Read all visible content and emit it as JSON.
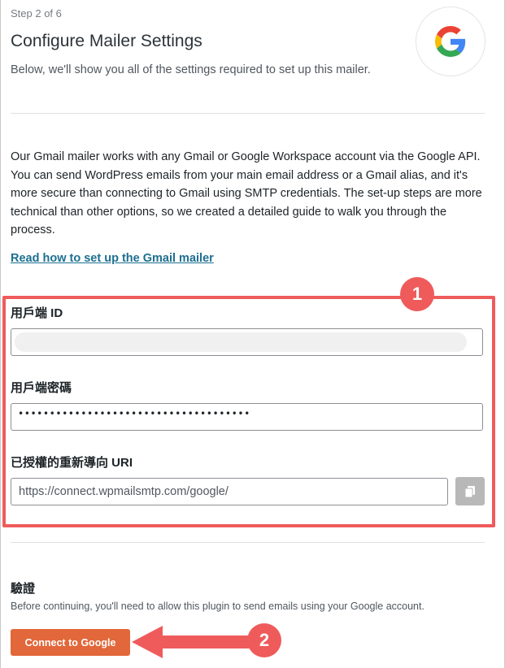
{
  "header": {
    "step": "Step 2 of 6",
    "title": "Configure Mailer Settings",
    "subtitle": "Below, we'll show you all of the settings required to set up this mailer.",
    "logo_icon": "google-g-logo"
  },
  "intro": {
    "description": "Our Gmail mailer works with any Gmail or Google Workspace account via the Google API. You can send WordPress emails from your main email address or a Gmail alias, and it's more secure than connecting to Gmail using SMTP credentials. The set-up steps are more technical than other options, so we created a detailed guide to walk you through the process.",
    "guide_link": "Read how to set up the Gmail mailer"
  },
  "fields": {
    "client_id_label": "用戶端 ID",
    "client_id_value": "",
    "client_secret_label": "用戶端密碼",
    "client_secret_value": "•••••••••••••••••••••••••••••••••••••",
    "redirect_uri_label": "已授權的重新導向 URI",
    "redirect_uri_value": "https://connect.wpmailsmtp.com/google/",
    "copy_icon": "copy-icon"
  },
  "annotations": {
    "badge_1": "1",
    "badge_2": "2",
    "highlight_color": "#ef5b5b"
  },
  "auth": {
    "title": "驗證",
    "description": "Before continuing, you'll need to allow this plugin to send emails using your Google account.",
    "connect_label": "Connect to Google",
    "connect_color": "#e2673a"
  }
}
